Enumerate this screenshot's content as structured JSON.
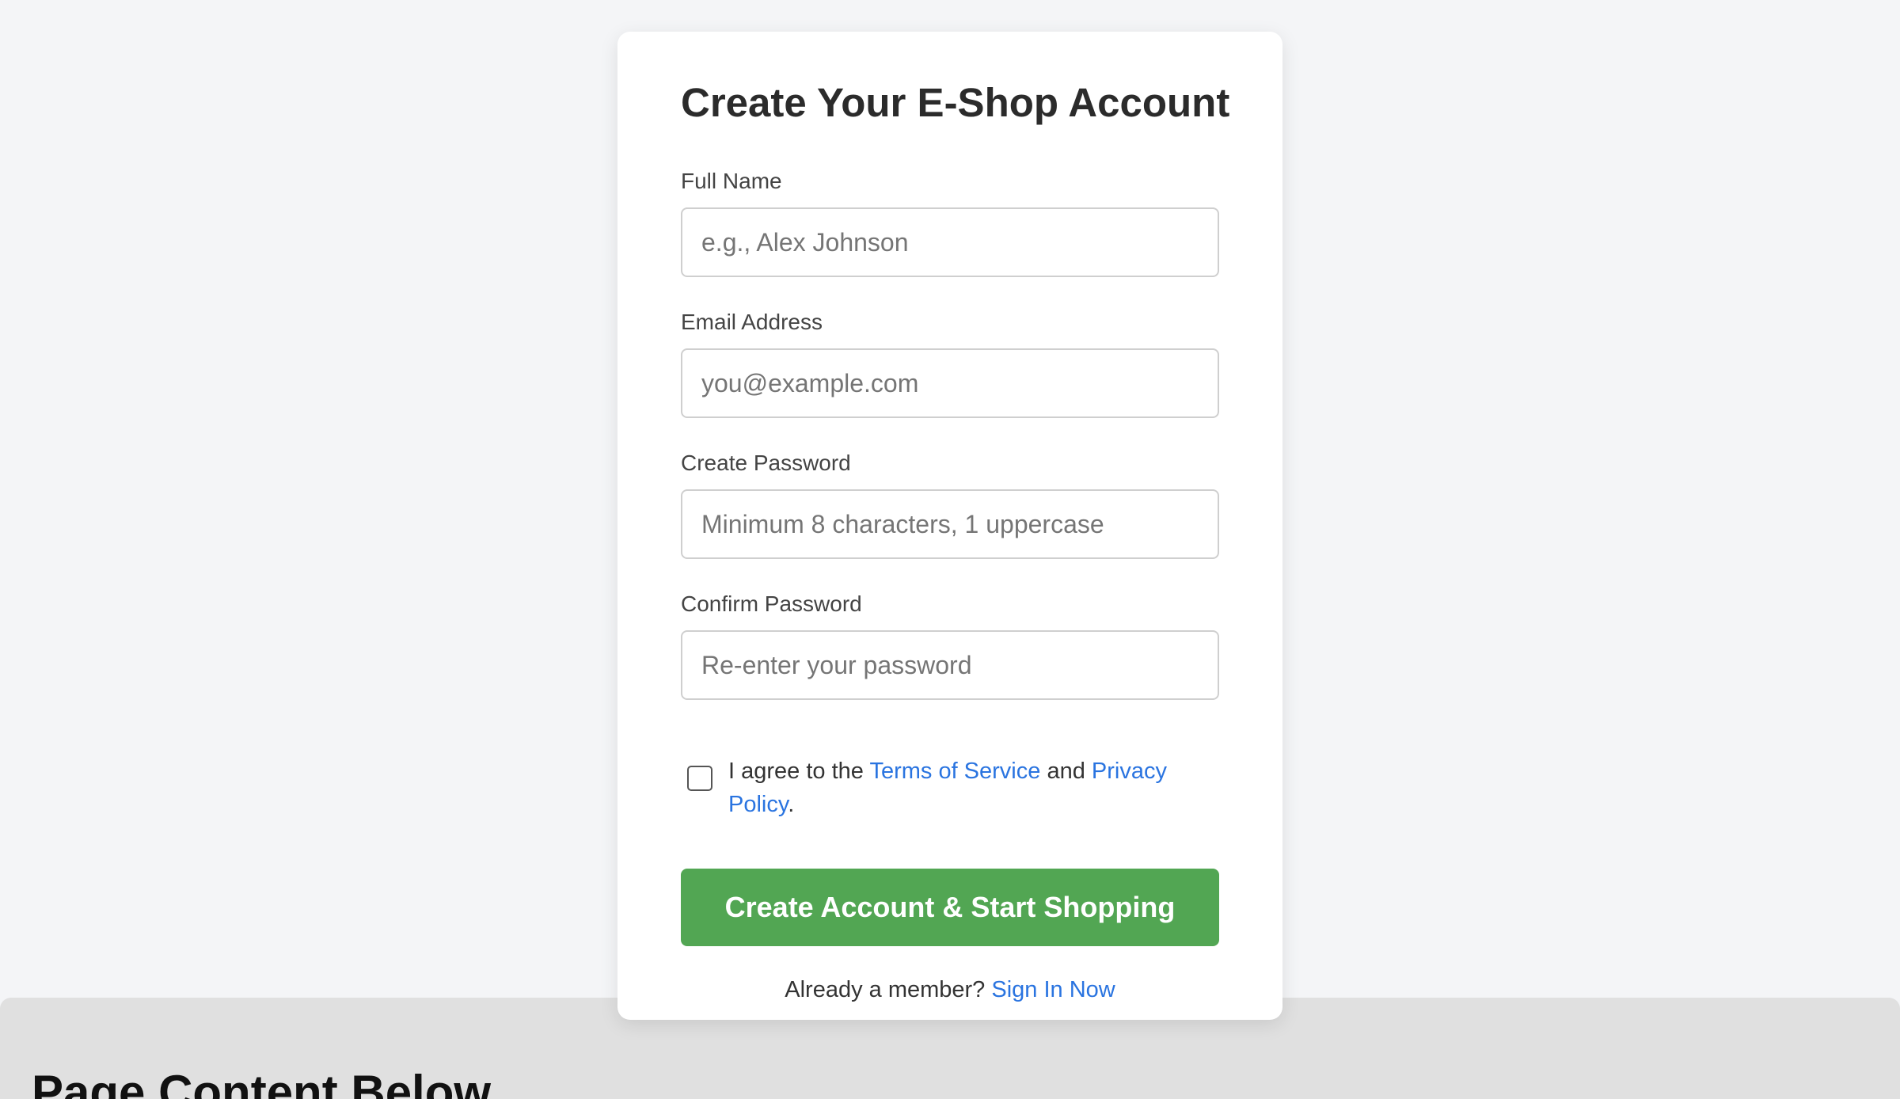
{
  "form": {
    "title": "Create Your E-Shop Account",
    "fields": [
      {
        "label": "Full Name",
        "placeholder": "e.g., Alex Johnson",
        "value": ""
      },
      {
        "label": "Email Address",
        "placeholder": "you@example.com",
        "value": ""
      },
      {
        "label": "Create Password",
        "placeholder": "Minimum 8 characters, 1 uppercase",
        "value": ""
      },
      {
        "label": "Confirm Password",
        "placeholder": "Re-enter your password",
        "value": ""
      }
    ],
    "terms": {
      "checked": false,
      "prefix": "I agree to the ",
      "terms_link": "Terms of Service",
      "conjunction": " and ",
      "privacy_link": "Privacy Policy",
      "suffix": "."
    },
    "submit_label": "Create Account & Start Shopping",
    "signin_prompt": "Already a member? ",
    "signin_link": "Sign In Now"
  },
  "below": {
    "title": "Page Content Below"
  },
  "colors": {
    "page_background": "#f4f5f7",
    "card_background": "#ffffff",
    "primary_button": "#52a653",
    "link": "#2a74e0",
    "lower_panel": "#e0e0e0"
  }
}
